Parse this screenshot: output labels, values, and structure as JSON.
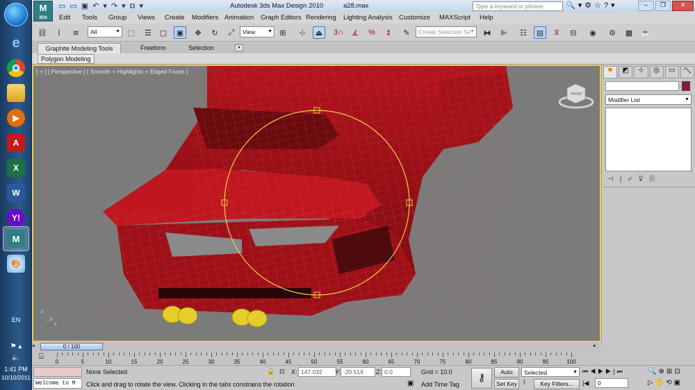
{
  "title": {
    "app": "Autodesk 3ds Max Design 2010",
    "file": "a28.max",
    "search_placeholder": "Type a keyword or phrase",
    "app_badge": "3DS"
  },
  "menu": [
    "Edit",
    "Tools",
    "Group",
    "Views",
    "Create",
    "Modifiers",
    "Animation",
    "Graph Editors",
    "Rendering",
    "Lighting Analysis",
    "Customize",
    "MAXScript",
    "Help"
  ],
  "toolbar": {
    "filter": "All",
    "refcoord": "View",
    "snap1": "3",
    "snap2": "%",
    "named_sel_placeholder": "Create Selection Se"
  },
  "ribbon": {
    "tabs": [
      "Graphite Modeling Tools",
      "Freeform",
      "Selection"
    ],
    "subtab": "Polygon Modeling"
  },
  "viewport": {
    "label": "[ + ] [ Perspective ] [ Smooth + Highlights + Edged Faces ]",
    "cube_label": "FRONT",
    "axis_x": "x",
    "axis_z": "z",
    "axis_y": "y"
  },
  "command_panel": {
    "modifier_list": "Modifier List",
    "color": "#8b1a3a"
  },
  "timeline": {
    "slider_label": "0 / 100",
    "ticks": [
      "0",
      "5",
      "10",
      "15",
      "20",
      "25",
      "30",
      "35",
      "40",
      "45",
      "50",
      "55",
      "60",
      "65",
      "70",
      "75",
      "80",
      "85",
      "90",
      "95",
      "100"
    ]
  },
  "status": {
    "listener": "Welcome to M",
    "selection": "None Selected",
    "prompt": "Click and drag to rotate the view.  Clicking in the tabs constrains the rotation",
    "x_label": "X:",
    "x": "147.032",
    "y_label": "Y:",
    "y": "-20.519",
    "z_label": "Z:",
    "z": "0.0",
    "grid": "Grid = 10.0",
    "add_time_tag": "Add Time Tag",
    "auto_key": "Auto Key",
    "set_key": "Set Key",
    "key_mode": "Selected",
    "key_filters": "Key Filters...",
    "frame": "0"
  },
  "taskbar": {
    "time": "1:41 PM",
    "date": "10/10/2011",
    "lang": "EN",
    "max_badge": "3DS"
  }
}
